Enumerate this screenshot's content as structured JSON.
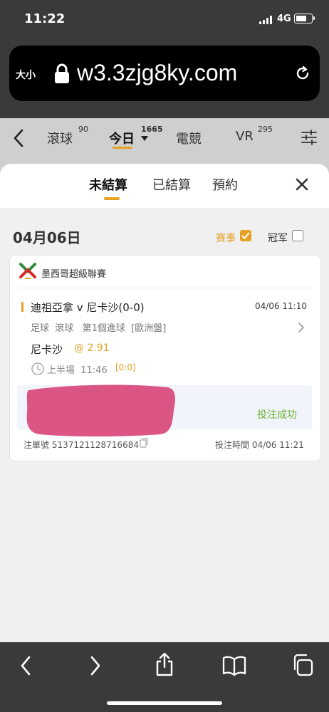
{
  "status_bar": {
    "time": "11:22",
    "network": "4G"
  },
  "browser": {
    "text_size_label": "大小",
    "url": "w3.3zjg8ky.com"
  },
  "nav": {
    "items": [
      {
        "label": "滾球",
        "count": "90"
      },
      {
        "label": "今日",
        "count": "1665"
      },
      {
        "label": "電競",
        "count": ""
      },
      {
        "label": "VR",
        "count": "295"
      }
    ]
  },
  "tabs": [
    {
      "label": "未結算",
      "active": true
    },
    {
      "label": "已結算",
      "active": false
    },
    {
      "label": "預約",
      "active": false
    }
  ],
  "filter": {
    "date": "04月06日",
    "event_label": "赛事",
    "event_checked": true,
    "champion_label": "冠军",
    "champion_checked": false
  },
  "bet": {
    "league": "墨西哥超級聯賽",
    "match": "迪祖亞拿 v 尼卡沙(0-0)",
    "match_time": "04/06 11:10",
    "meta": "足球  滾球   第1個進球  [歐洲盤]",
    "pick": "尼卡沙",
    "odds": "@ 2.91",
    "period": "上半場  11:46",
    "score": "[0:0]",
    "status": "投注成功",
    "slip_no": "注單號 5137121128716684",
    "bet_time": "投注時間 04/06 11:21"
  },
  "colors": {
    "accent": "#e6a122",
    "success": "#67b02a",
    "redaction": "#d9477a"
  }
}
